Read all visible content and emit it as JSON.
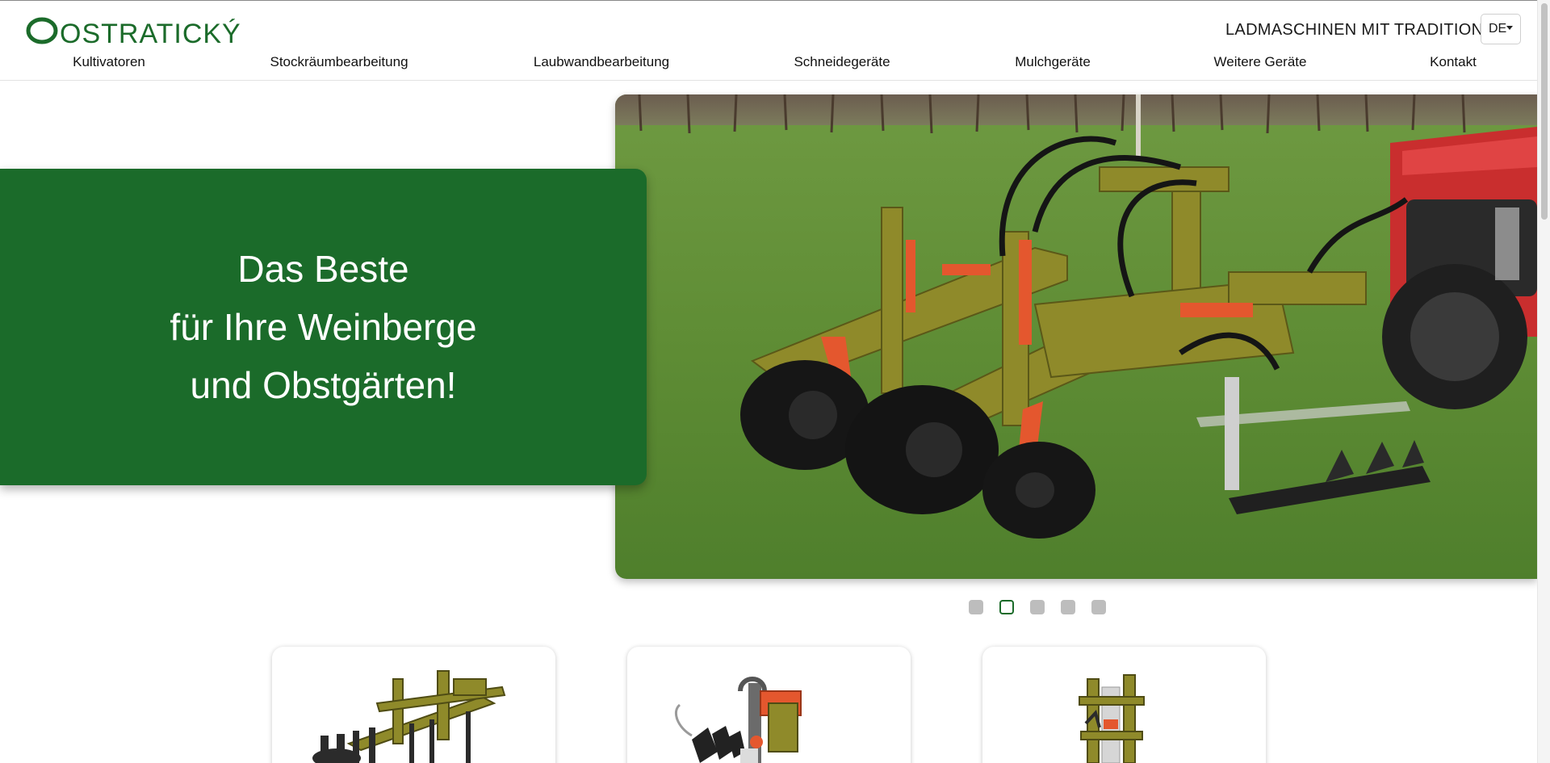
{
  "header": {
    "logo_text": "OSTRATICKÝ",
    "tagline": "LADMASCHINEN MIT TRADITION",
    "language": "DE"
  },
  "nav": [
    {
      "label": "Kultivatoren"
    },
    {
      "label": "Stockräumbearbeitung"
    },
    {
      "label": "Laubwandbearbeitung"
    },
    {
      "label": "Schneidegeräte"
    },
    {
      "label": "Mulchgeräte"
    },
    {
      "label": "Weitere Geräte"
    },
    {
      "label": "Kontakt"
    }
  ],
  "hero": {
    "lines": [
      "Das Beste",
      "für Ihre Weinberge",
      "und Obstgärten!"
    ],
    "image": "vineyard-cultivator-photo"
  },
  "carousel": {
    "slide_count": 5,
    "active_index": 1
  },
  "products": [
    {
      "image": "cultivator-product-image"
    },
    {
      "image": "inter-row-tool-product-image"
    },
    {
      "image": "hedge-trimmer-product-image"
    }
  ],
  "colors": {
    "brand_green": "#1b6b2a",
    "machine_olive": "#8f8a2a",
    "accent_orange": "#e4572e"
  }
}
